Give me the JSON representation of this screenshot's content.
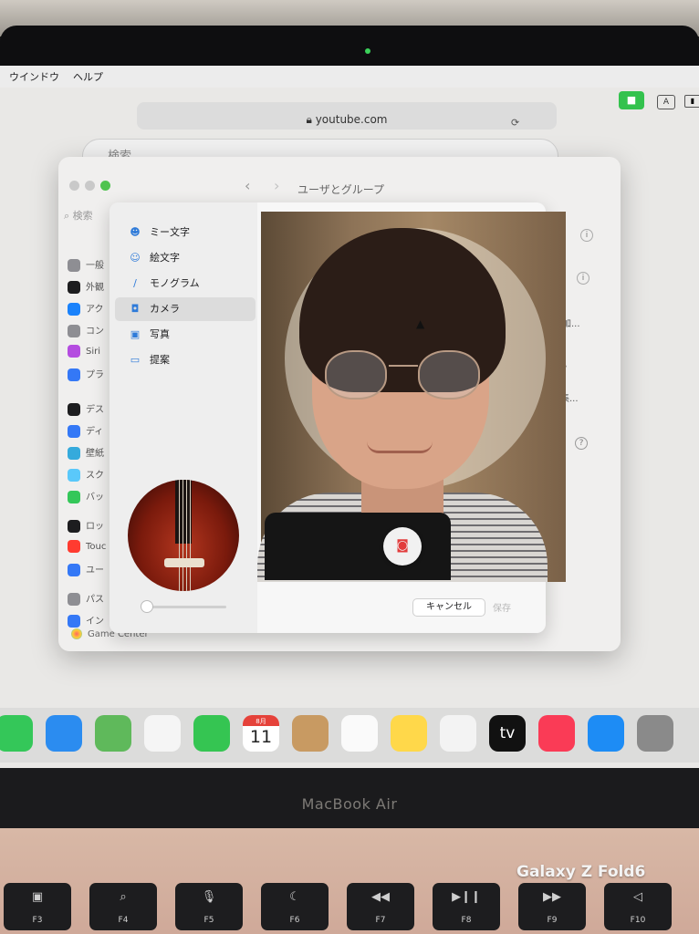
{
  "device": {
    "brand_label": "MacBook Air",
    "watermark": "Galaxy Z Fold6"
  },
  "menubar": {
    "items": [
      "ウインドウ",
      "ヘルプ"
    ],
    "a_key": "A"
  },
  "browser": {
    "url": "youtube.com",
    "search_placeholder": "検索"
  },
  "settings_window": {
    "title": "ユーザとグループ",
    "sidebar_search": "検索",
    "sidebar_items": [
      {
        "label": "一般",
        "color": "#8e8e93"
      },
      {
        "label": "外観",
        "color": "#1d1d1f"
      },
      {
        "label": "アク",
        "color": "#1a82fb"
      },
      {
        "label": "コン",
        "color": "#8e8e93"
      },
      {
        "label": "Siri",
        "color": "#b44ce0"
      },
      {
        "label": "プラ",
        "color": "#3478f6"
      },
      {
        "label": "デス",
        "color": "#1d1d1f"
      },
      {
        "label": "ディ",
        "color": "#3478f6"
      },
      {
        "label": "壁紙",
        "color": "#35aadc"
      },
      {
        "label": "スク",
        "color": "#5ac8fa"
      },
      {
        "label": "バッ",
        "color": "#34c759"
      },
      {
        "label": "ロッ",
        "color": "#1d1d1f"
      },
      {
        "label": "Touc",
        "color": "#ff3b30"
      },
      {
        "label": "ユー",
        "color": "#3478f6"
      },
      {
        "label": "パス",
        "color": "#8e8e93"
      },
      {
        "label": "イン",
        "color": "#3478f6"
      }
    ],
    "game_center": "Game Center",
    "right_partial": [
      "追加...",
      "フ",
      "集..."
    ]
  },
  "picker": {
    "sources": [
      {
        "label": "ミー文字",
        "icon": "memoji-icon",
        "glyph": "☻"
      },
      {
        "label": "絵文字",
        "icon": "emoji-icon",
        "glyph": "☺"
      },
      {
        "label": "モノグラム",
        "icon": "monogram-icon",
        "glyph": "∕"
      },
      {
        "label": "カメラ",
        "icon": "camera-icon",
        "glyph": "◘"
      },
      {
        "label": "写真",
        "icon": "photos-icon",
        "glyph": "▣"
      },
      {
        "label": "提案",
        "icon": "folder-icon",
        "glyph": "▭"
      }
    ],
    "selected_source": "カメラ",
    "cancel_label": "キャンセル",
    "save_label": "保存"
  },
  "dock": {
    "apps": [
      {
        "name": "messages",
        "color": "#34c759"
      },
      {
        "name": "mail",
        "color": "#2b8cf0"
      },
      {
        "name": "maps",
        "color": "#5fb95b"
      },
      {
        "name": "photos",
        "color": "#f5f5f5"
      },
      {
        "name": "facetime",
        "color": "#35c552"
      },
      {
        "name": "calendar",
        "color": "#ffffff",
        "month": "8月",
        "day": "11"
      },
      {
        "name": "contacts",
        "color": "#c89a62"
      },
      {
        "name": "reminders",
        "color": "#fafafa"
      },
      {
        "name": "notes",
        "color": "#ffd84a"
      },
      {
        "name": "freeform",
        "color": "#f3f3f3"
      },
      {
        "name": "apple-tv",
        "color": "#111111",
        "label": "tv"
      },
      {
        "name": "music",
        "color": "#fa3b56"
      },
      {
        "name": "app-store",
        "color": "#1d8cf5"
      },
      {
        "name": "system-settings",
        "color": "#8a8a8a"
      }
    ]
  },
  "keyboard": {
    "keys": [
      {
        "f": "F3",
        "glyph": "▣"
      },
      {
        "f": "F4",
        "glyph": "⌕"
      },
      {
        "f": "F5",
        "glyph": "🎙"
      },
      {
        "f": "F6",
        "glyph": "☾"
      },
      {
        "f": "F7",
        "glyph": "◀◀"
      },
      {
        "f": "F8",
        "glyph": "▶❙❙"
      },
      {
        "f": "F9",
        "glyph": "▶▶"
      },
      {
        "f": "F10",
        "glyph": "◁"
      }
    ]
  }
}
